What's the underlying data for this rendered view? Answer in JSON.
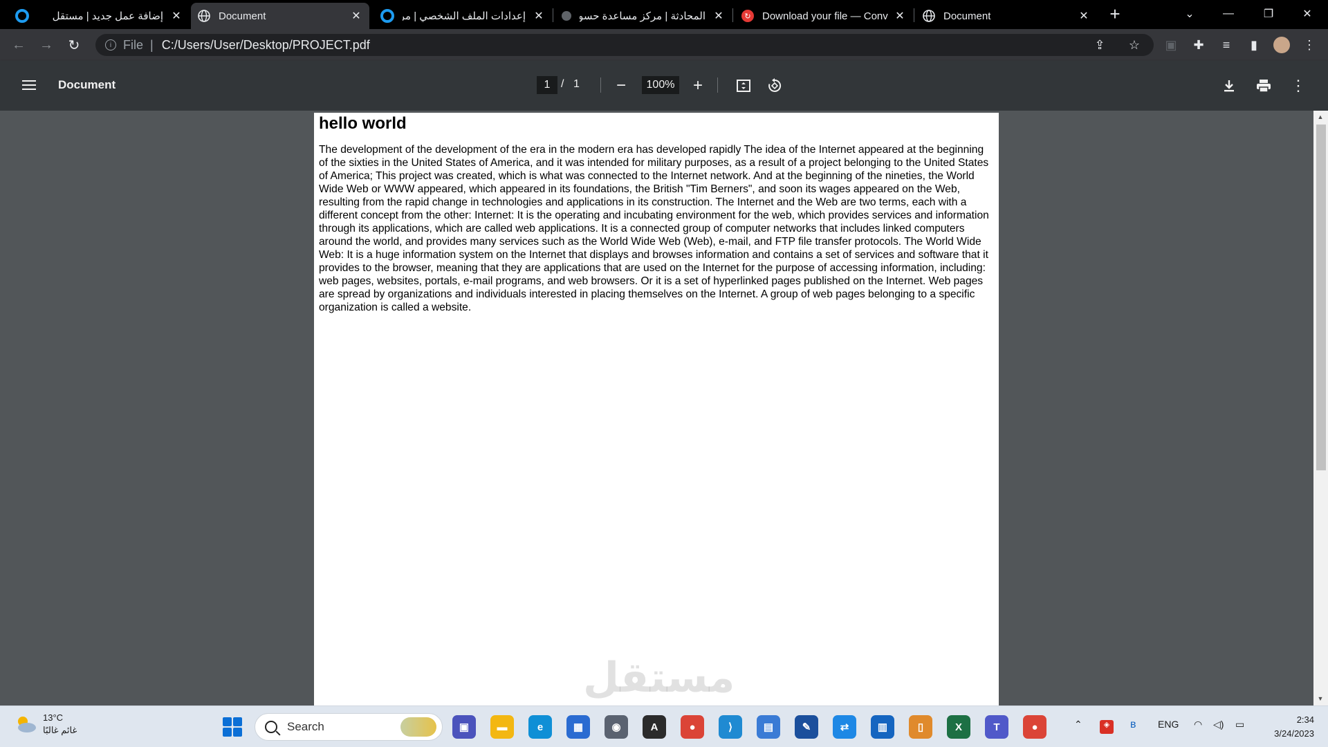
{
  "browser": {
    "tabs": [
      {
        "title": "إضافة عمل جديد | مستقل",
        "icon": "mostaql-icon",
        "color": "#1d9bf0",
        "active": false
      },
      {
        "title": "Document",
        "icon": "globe-icon",
        "color": "#e8eaed",
        "active": true
      },
      {
        "title": "إعدادات الملف الشخصي | مرك",
        "icon": "mostaql-icon",
        "color": "#1d9bf0",
        "active": false
      },
      {
        "title": "المحادثة | مركز مساعدة حسوب",
        "icon": "loading-icon",
        "color": "#5f6368",
        "active": false
      },
      {
        "title": "Download your file — Conv",
        "icon": "convert-icon",
        "color": "#e53935",
        "active": false
      },
      {
        "title": "Document",
        "icon": "globe-icon",
        "color": "#e8eaed",
        "active": false
      }
    ],
    "new_tab_label": "+",
    "address": {
      "scheme_label": "File",
      "separator": "|",
      "url": "C:/Users/User/Desktop/PROJECT.pdf"
    }
  },
  "pdf_viewer": {
    "title": "Document",
    "current_page": "1",
    "page_separator": "/",
    "total_pages": "1",
    "zoom": "100%"
  },
  "document": {
    "heading": "hello world",
    "body": "The development of the development of the era in the modern era has developed rapidly The idea of the Internet appeared at the beginning of the sixties in the United States of America, and it was intended for military purposes, as a result of a project belonging to the United States of America; This project was created, which is what was connected to the Internet network. And at the beginning of the nineties, the World Wide Web or WWW appeared, which appeared in its foundations, the British \"Tim Berners\", and soon its wages appeared on the Web, resulting from the rapid change in technologies and applications in its construction. The Internet and the Web are two terms, each with a different concept from the other: Internet: It is the operating and incubating environment for the web, which provides services and information through its applications, which are called web applications. It is a connected group of computer networks that includes linked computers around the world, and provides many services such as the World Wide Web (Web), e-mail, and FTP file transfer protocols. The World Wide Web: It is a huge information system on the Internet that displays and browses information and contains a set of services and software that it provides to the browser, meaning that they are applications that are used on the Internet for the purpose of accessing information, including: web pages, websites, portals, e-mail programs, and web browsers. Or it is a set of hyperlinked pages published on the Internet. Web pages are spread by organizations and individuals interested in placing themselves on the Internet. A group of web pages belonging to a specific organization is called a website."
  },
  "watermark": "مستقل",
  "taskbar": {
    "weather_temp": "13°C",
    "weather_desc": "غائم غالبًا",
    "search_label": "Search",
    "language": "ENG",
    "time": "2:34",
    "date": "3/24/2023",
    "apps": [
      {
        "name": "teams-meet-icon",
        "label": "▣",
        "color": "#4b53bc"
      },
      {
        "name": "file-explorer-icon",
        "label": "▬",
        "color": "#f3b712"
      },
      {
        "name": "edge-icon",
        "label": "e",
        "color": "#0f8fd6"
      },
      {
        "name": "microsoft-store-icon",
        "label": "▦",
        "color": "#2a6bd1"
      },
      {
        "name": "camera-icon",
        "label": "◉",
        "color": "#5a6270"
      },
      {
        "name": "affinity-icon",
        "label": "A",
        "color": "#2b2b2b"
      },
      {
        "name": "chrome-icon",
        "label": "●",
        "color": "#db4437"
      },
      {
        "name": "vscode-icon",
        "label": "⟩",
        "color": "#1f8ad2"
      },
      {
        "name": "office-icon",
        "label": "▤",
        "color": "#3a7bd5"
      },
      {
        "name": "drawing-app-icon",
        "label": "✎",
        "color": "#1b4f9c"
      },
      {
        "name": "remote-desktop-icon",
        "label": "⇄",
        "color": "#1e88e5"
      },
      {
        "name": "kiosk-icon",
        "label": "▥",
        "color": "#1565c0"
      },
      {
        "name": "notebook-icon",
        "label": "▯",
        "color": "#e08a2c"
      },
      {
        "name": "excel-icon",
        "label": "X",
        "color": "#1d7044"
      },
      {
        "name": "teams-icon",
        "label": "T",
        "color": "#5059c9"
      },
      {
        "name": "chrome-profile-icon",
        "label": "●",
        "color": "#db4437"
      }
    ]
  }
}
